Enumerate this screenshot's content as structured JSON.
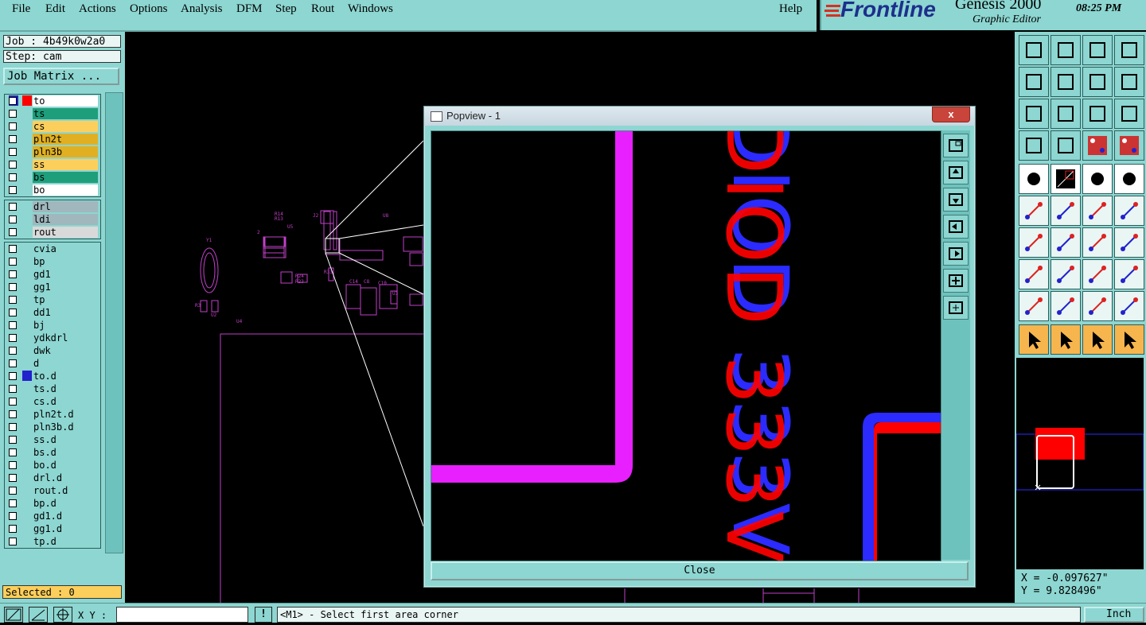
{
  "menu": {
    "items": [
      "File",
      "Edit",
      "Actions",
      "Options",
      "Analysis",
      "DFM",
      "Step",
      "Rout",
      "Windows"
    ],
    "help": "Help"
  },
  "brand": {
    "logo": "Frontline",
    "product": "Genesis 2000",
    "subtitle": "Graphic Editor",
    "time": "08:25 PM"
  },
  "left_panel": {
    "job": "Job : 4b49k0w2a0",
    "step": "Step: cam",
    "job_matrix": "Job Matrix ...",
    "layers_board": [
      {
        "name": "to",
        "color": "#ffffff",
        "active": true
      },
      {
        "name": "ts",
        "color": "#1f9e7b"
      },
      {
        "name": "cs",
        "color": "#fccf5c"
      },
      {
        "name": "pln2t",
        "color": "#e0b022"
      },
      {
        "name": "pln3b",
        "color": "#e0b022"
      },
      {
        "name": "ss",
        "color": "#fccf5c"
      },
      {
        "name": "bs",
        "color": "#1f9e7b"
      },
      {
        "name": "bo",
        "color": "#ffffff"
      }
    ],
    "layers_drill": [
      {
        "name": "drl",
        "color": "#9fb7bd"
      },
      {
        "name": "ldi",
        "color": "#9fb7bd"
      },
      {
        "name": "rout",
        "color": "#d9d9d9"
      }
    ],
    "layers_misc": [
      {
        "name": "cvia"
      },
      {
        "name": "bp"
      },
      {
        "name": "gd1"
      },
      {
        "name": "gg1"
      },
      {
        "name": "tp"
      },
      {
        "name": "dd1"
      },
      {
        "name": "bj"
      },
      {
        "name": "ydkdrl"
      },
      {
        "name": "dwk"
      },
      {
        "name": "d"
      },
      {
        "name": "to.d",
        "marker": true
      },
      {
        "name": "ts.d"
      },
      {
        "name": "cs.d"
      },
      {
        "name": "pln2t.d"
      },
      {
        "name": "pln3b.d"
      },
      {
        "name": "ss.d"
      },
      {
        "name": "bs.d"
      },
      {
        "name": "bo.d"
      },
      {
        "name": "drl.d"
      },
      {
        "name": "rout.d"
      },
      {
        "name": "bp.d"
      },
      {
        "name": "gd1.d"
      },
      {
        "name": "gg1.d"
      },
      {
        "name": "tp.d"
      }
    ],
    "selected": "Selected : 0"
  },
  "popview": {
    "title": "Popview - 1",
    "close_x": "x",
    "close_button": "Close",
    "text_red": "DIOD 333V",
    "text_blue": "DIOD 333V"
  },
  "canvas": {
    "labels": [
      "R14",
      "R13",
      "U5",
      "J2",
      "U8",
      "Y1",
      "R24",
      "R23",
      "R33",
      "C14",
      "C8",
      "C10",
      "U3",
      "U4",
      "R3",
      "U2",
      "2"
    ]
  },
  "coords": {
    "x": "X = -0.097627\"",
    "y": "Y = 9.828496\""
  },
  "bottom": {
    "xy_label": "X Y :",
    "xy_value": "",
    "exclaim": "!",
    "status": "<M1> - Select first area corner",
    "unit": "Inch"
  },
  "colors": {
    "panel": "#8dd6d1",
    "magenta": "#e820ff",
    "red": "#ff0000",
    "blue": "#2b2bff",
    "outline": "#c040c8"
  }
}
